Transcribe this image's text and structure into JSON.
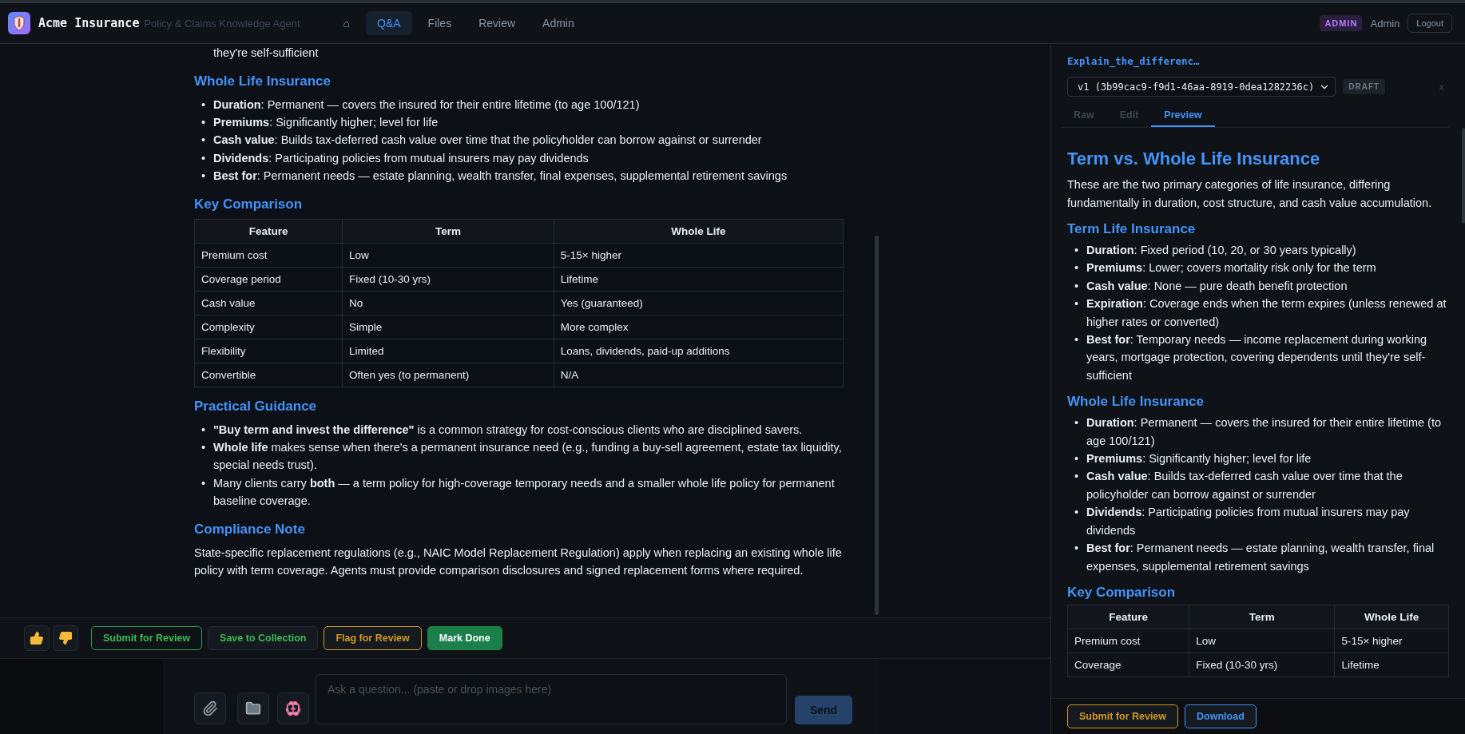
{
  "app": {
    "name": "Acme Insurance",
    "subtitle": "Policy & Claims Knowledge Agent"
  },
  "nav": [
    {
      "label": "⌂",
      "selected": false
    },
    {
      "label": "Q&A",
      "selected": true
    },
    {
      "label": "Files",
      "selected": false
    },
    {
      "label": "Review",
      "selected": false
    },
    {
      "label": "Admin",
      "selected": false
    }
  ],
  "user": {
    "role_badge": "ADMIN",
    "name": "Admin",
    "logout": "Logout"
  },
  "answer": {
    "blocks": [
      {
        "kind": "fragment",
        "text": "they're self-sufficient"
      },
      {
        "kind": "heading",
        "text": "Whole Life Insurance"
      },
      {
        "kind": "list",
        "marker": "•",
        "items": [
          "**Duration**: Permanent — covers the insured for their entire lifetime (to age 100/121)",
          "**Premiums**: Significantly higher; level for life",
          "**Cash value**: Builds tax-deferred cash value over time that the policyholder can borrow against or surrender",
          "**Dividends**: Participating policies from mutual insurers may pay dividends",
          "**Best for**: Permanent needs — estate planning, wealth transfer, final expenses, supplemental retirement savings"
        ]
      },
      {
        "kind": "heading",
        "text": "Key Comparison"
      },
      {
        "kind": "table",
        "columns": [
          "Feature",
          "Term",
          "Whole Life"
        ],
        "rows": [
          [
            "Premium cost",
            "Low",
            "5-15× higher"
          ],
          [
            "Coverage period",
            "Fixed (10-30 yrs)",
            "Lifetime"
          ],
          [
            "Cash value",
            "No",
            "Yes (guaranteed)"
          ],
          [
            "Complexity",
            "Simple",
            "More complex"
          ],
          [
            "Flexibility",
            "Limited",
            "Loans, dividends, paid-up additions"
          ],
          [
            "Convertible",
            "Often yes (to permanent)",
            "N/A"
          ]
        ]
      },
      {
        "kind": "heading",
        "text": "Practical Guidance"
      },
      {
        "kind": "list",
        "marker": "•",
        "items": [
          "**\"Buy term and invest the difference\"** is a common strategy for cost-conscious clients who are disciplined savers.",
          "**Whole life** makes sense when there's a permanent insurance need (e.g., funding a buy-sell agreement, estate tax liquidity, special needs trust).",
          "Many clients carry **both** — a term policy for high-coverage temporary needs and a smaller whole life policy for permanent baseline coverage."
        ]
      },
      {
        "kind": "heading",
        "text": "Compliance Note"
      },
      {
        "kind": "paragraph",
        "text": "State-specific replacement regulations (e.g., NAIC Model Replacement Regulation) apply when replacing an existing whole life policy with term coverage. Agents must provide comparison disclosures and signed replacement forms where required."
      }
    ]
  },
  "actions": [
    {
      "label": "Submit for Review",
      "kind": "outline-green"
    },
    {
      "label": "Save to Collection",
      "kind": "muted"
    },
    {
      "label": "Flag for Review",
      "kind": "outline-orange"
    },
    {
      "label": "Mark Done",
      "kind": "solid-green"
    }
  ],
  "composer": {
    "placeholder": "Ask a question... (paste or drop images here)",
    "send": "Send"
  },
  "panel": {
    "file_title": "Explain_the_differenc…",
    "version": "v1 (3b99cac9-f9d1-46aa-8919-0dea1282236c)",
    "status": "DRAFT",
    "close": "x",
    "tabs": [
      {
        "label": "Raw",
        "selected": false
      },
      {
        "label": "Edit",
        "selected": false
      },
      {
        "label": "Preview",
        "selected": true
      }
    ],
    "title": "Term vs. Whole Life Insurance",
    "blocks": [
      {
        "kind": "paragraph",
        "text": "These are the two primary categories of life insurance, differing fundamentally in duration, cost structure, and cash value accumulation."
      },
      {
        "kind": "heading",
        "text": "Term Life Insurance"
      },
      {
        "kind": "list",
        "marker": "•",
        "items": [
          "**Duration**: Fixed period (10, 20, or 30 years typically)",
          "**Premiums**: Lower; covers mortality risk only for the term",
          "**Cash value**: None — pure death benefit protection",
          "**Expiration**: Coverage ends when the term expires (unless renewed at higher rates or converted)",
          "**Best for**: Temporary needs — income replacement during working years, mortgage protection, covering dependents until they're self-sufficient"
        ]
      },
      {
        "kind": "heading",
        "text": "Whole Life Insurance"
      },
      {
        "kind": "list",
        "marker": "•",
        "items": [
          "**Duration**: Permanent — covers the insured for their entire lifetime (to age 100/121)",
          "**Premiums**: Significantly higher; level for life",
          "**Cash value**: Builds tax-deferred cash value over time that the policyholder can borrow against or surrender",
          "**Dividends**: Participating policies from mutual insurers may pay dividends",
          "**Best for**: Permanent needs — estate planning, wealth transfer, final expenses, supplemental retirement savings"
        ]
      },
      {
        "kind": "heading",
        "text": "Key Comparison"
      },
      {
        "kind": "table",
        "columns": [
          "Feature",
          "Term",
          "Whole Life"
        ],
        "rows": [
          [
            "Premium cost",
            "Low",
            "5-15× higher"
          ],
          [
            "Coverage",
            "Fixed (10-30 yrs)",
            "Lifetime"
          ]
        ]
      }
    ],
    "footer": [
      {
        "label": "Submit for Review",
        "kind": "outline-orange"
      },
      {
        "label": "Download",
        "kind": "outline-blue"
      }
    ]
  }
}
